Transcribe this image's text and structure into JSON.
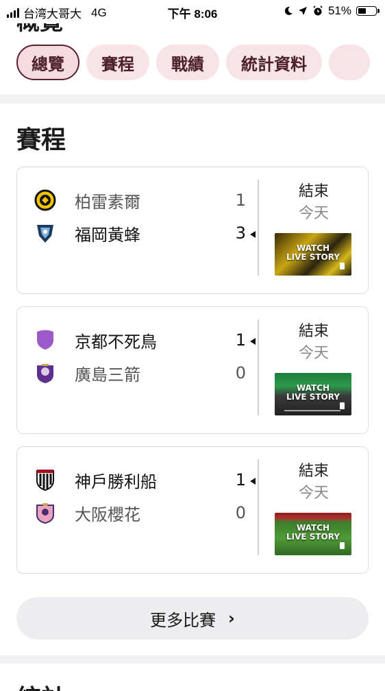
{
  "status_bar": {
    "carrier": "台湾大哥大",
    "network": "4G",
    "time": "下午 8:06",
    "battery": "51%",
    "battery_level": 0.51,
    "icons": [
      "signal-icon",
      "moon-icon",
      "location-arrow-icon",
      "alarm-icon",
      "battery-icon"
    ]
  },
  "header": {
    "partial_title": "概覽"
  },
  "tabs": [
    {
      "label": "總覽",
      "active": true
    },
    {
      "label": "賽程",
      "active": false
    },
    {
      "label": "戰績",
      "active": false
    },
    {
      "label": "統計資料",
      "active": false
    }
  ],
  "fixtures": {
    "title": "賽程",
    "matches": [
      {
        "home": {
          "name": "柏雷素爾",
          "score": "1",
          "winner": false,
          "crest": "kashiwa-crest-icon"
        },
        "away": {
          "name": "福岡黃蜂",
          "score": "3",
          "winner": true,
          "crest": "fukuoka-crest-icon"
        },
        "status": "結束",
        "day": "今天",
        "video_label": "WATCH LIVE STORY"
      },
      {
        "home": {
          "name": "京都不死鳥",
          "score": "1",
          "winner": true,
          "crest": "kyoto-crest-icon"
        },
        "away": {
          "name": "廣島三箭",
          "score": "0",
          "winner": false,
          "crest": "hiroshima-crest-icon"
        },
        "status": "結束",
        "day": "今天",
        "video_label": "WATCH LIVE STORY"
      },
      {
        "home": {
          "name": "神戶勝利船",
          "score": "1",
          "winner": true,
          "crest": "kobe-crest-icon"
        },
        "away": {
          "name": "大阪櫻花",
          "score": "0",
          "winner": false,
          "crest": "cerezo-crest-icon"
        },
        "status": "結束",
        "day": "今天",
        "video_label": "WATCH LIVE STORY"
      }
    ],
    "more_button": "更多比賽"
  },
  "colors": {
    "tab_bg": "#f8e3e6",
    "tab_text": "#4a1f2a",
    "accent": "#5a1f30"
  }
}
